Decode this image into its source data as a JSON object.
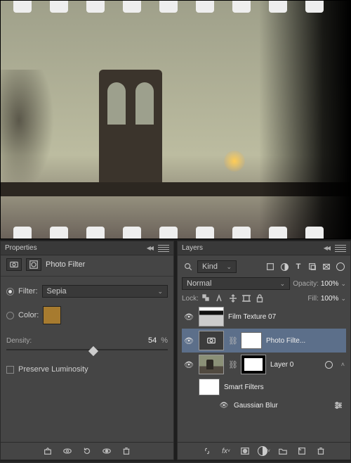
{
  "properties": {
    "title": "Properties",
    "filter_title": "Photo Filter",
    "filter_label": "Filter:",
    "filter_value": "Sepia",
    "color_label": "Color:",
    "color_hex": "#a77b2f",
    "density_label": "Density:",
    "density_value": "54",
    "density_unit": "%",
    "preserve_label": "Preserve Luminosity",
    "filter_radio_on": true,
    "color_radio_on": false,
    "preserve_checked": false
  },
  "layers": {
    "title": "Layers",
    "kind_label": "Kind",
    "blend_mode": "Normal",
    "opacity_label": "Opacity:",
    "opacity_value": "100%",
    "lock_label": "Lock:",
    "fill_label": "Fill:",
    "fill_value": "100%",
    "items": [
      {
        "name": "Film Texture 07"
      },
      {
        "name": "Photo Filte..."
      },
      {
        "name": "Layer 0"
      },
      {
        "name": "Smart Filters"
      },
      {
        "name": "Gaussian Blur"
      }
    ]
  }
}
